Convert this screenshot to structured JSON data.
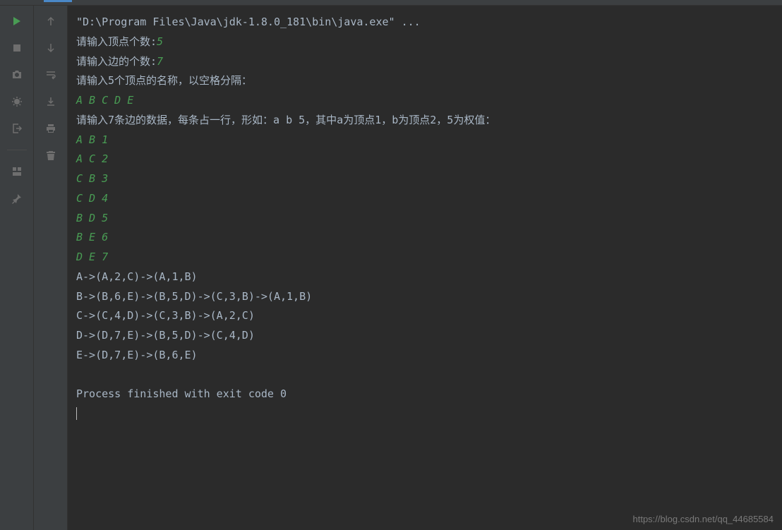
{
  "console": {
    "command": "\"D:\\Program Files\\Java\\jdk-1.8.0_181\\bin\\java.exe\" ...",
    "lines": [
      {
        "type": "mixed",
        "output": "请输入顶点个数:",
        "input": "5"
      },
      {
        "type": "mixed",
        "output": "请输入边的个数:",
        "input": "7"
      },
      {
        "type": "output",
        "text": "请输入5个顶点的名称，以空格分隔："
      },
      {
        "type": "input",
        "text": "A B C D E"
      },
      {
        "type": "output",
        "text": "请输入7条边的数据，每条占一行，形如：a b 5，其中a为顶点1，b为顶点2，5为权值："
      },
      {
        "type": "input",
        "text": "A B 1"
      },
      {
        "type": "input",
        "text": "A C 2"
      },
      {
        "type": "input",
        "text": "C B 3"
      },
      {
        "type": "input",
        "text": "C D 4"
      },
      {
        "type": "input",
        "text": "B D 5"
      },
      {
        "type": "input",
        "text": "B E 6"
      },
      {
        "type": "input",
        "text": "D E 7"
      },
      {
        "type": "output",
        "text": "A->(A,2,C)->(A,1,B)"
      },
      {
        "type": "output",
        "text": "B->(B,6,E)->(B,5,D)->(C,3,B)->(A,1,B)"
      },
      {
        "type": "output",
        "text": "C->(C,4,D)->(C,3,B)->(A,2,C)"
      },
      {
        "type": "output",
        "text": "D->(D,7,E)->(B,5,D)->(C,4,D)"
      },
      {
        "type": "output",
        "text": "E->(D,7,E)->(B,6,E)"
      },
      {
        "type": "output",
        "text": ""
      },
      {
        "type": "output",
        "text": "Process finished with exit code 0"
      }
    ]
  },
  "watermark": "https://blog.csdn.net/qq_44685584"
}
